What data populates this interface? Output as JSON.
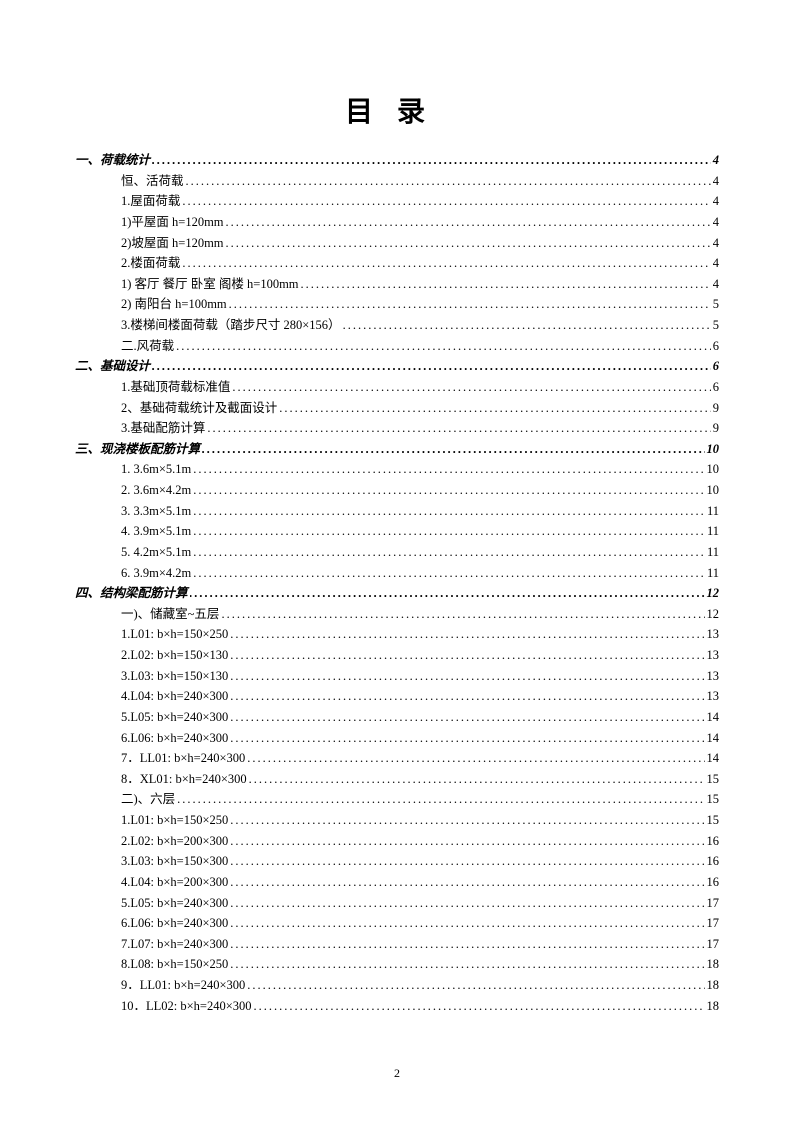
{
  "title": "目录",
  "pageNumber": "2",
  "toc": [
    {
      "level": 1,
      "label": "一、荷载统计",
      "page": "4"
    },
    {
      "level": 2,
      "label": "恒、活荷载",
      "page": "4"
    },
    {
      "level": 2,
      "label": "1.屋面荷载",
      "page": "4"
    },
    {
      "level": 2,
      "label": "1)平屋面  h=120mm",
      "page": "4"
    },
    {
      "level": 2,
      "label": "2)坡屋面  h=120mm",
      "page": "4"
    },
    {
      "level": 2,
      "label": "2.楼面荷载",
      "page": "4"
    },
    {
      "level": 2,
      "label": "1)    客厅  餐厅  卧室  阁楼 h=100mm",
      "page": "4"
    },
    {
      "level": 2,
      "label": "2)    南阳台 h=100mm",
      "page": "5"
    },
    {
      "level": 2,
      "label": "3.楼梯间楼面荷载（踏步尺寸 280×156）",
      "page": "5"
    },
    {
      "level": 2,
      "label": "二.风荷载",
      "page": "6"
    },
    {
      "level": 1,
      "label": "二、基础设计",
      "page": "6"
    },
    {
      "level": 2,
      "label": "1.基础顶荷载标准值",
      "page": "6"
    },
    {
      "level": 2,
      "label": "2、基础荷载统计及截面设计",
      "page": "9"
    },
    {
      "level": 2,
      "label": "3.基础配筋计算",
      "page": "9"
    },
    {
      "level": 1,
      "label": "三、现浇楼板配筋计算",
      "page": "10"
    },
    {
      "level": 2,
      "label": "1.     3.6m×5.1m",
      "page": "10"
    },
    {
      "level": 2,
      "label": "2.     3.6m×4.2m",
      "page": "10"
    },
    {
      "level": 2,
      "label": "3.     3.3m×5.1m",
      "page": "11"
    },
    {
      "level": 2,
      "label": "4.     3.9m×5.1m",
      "page": "11"
    },
    {
      "level": 2,
      "label": "5.     4.2m×5.1m",
      "page": "11"
    },
    {
      "level": 2,
      "label": "6.     3.9m×4.2m",
      "page": "11"
    },
    {
      "level": 1,
      "label": "四、结构梁配筋计算",
      "page": "12"
    },
    {
      "level": 2,
      "label": "一)、储藏室~五层",
      "page": "12"
    },
    {
      "level": 2,
      "label": "1.L01:    b×h=150×250",
      "page": "13"
    },
    {
      "level": 2,
      "label": "2.L02:    b×h=150×130",
      "page": "13"
    },
    {
      "level": 2,
      "label": "3.L03:    b×h=150×130",
      "page": "13"
    },
    {
      "level": 2,
      "label": "4.L04:    b×h=240×300",
      "page": "13"
    },
    {
      "level": 2,
      "label": "5.L05:    b×h=240×300",
      "page": "14"
    },
    {
      "level": 2,
      "label": "6.L06:    b×h=240×300",
      "page": "14"
    },
    {
      "level": 2,
      "label": "7．LL01:    b×h=240×300",
      "page": "14"
    },
    {
      "level": 2,
      "label": "8．XL01: b×h=240×300",
      "page": "15"
    },
    {
      "level": 2,
      "label": "二)、六层",
      "page": "15"
    },
    {
      "level": 2,
      "label": "1.L01: b×h=150×250",
      "page": "15"
    },
    {
      "level": 2,
      "label": "2.L02: b×h=200×300",
      "page": "16"
    },
    {
      "level": 2,
      "label": "3.L03: b×h=150×300",
      "page": "16"
    },
    {
      "level": 2,
      "label": "4.L04: b×h=200×300",
      "page": "16"
    },
    {
      "level": 2,
      "label": "5.L05:    b×h=240×300",
      "page": "17"
    },
    {
      "level": 2,
      "label": "6.L06:    b×h=240×300",
      "page": "17"
    },
    {
      "level": 2,
      "label": "7.L07:    b×h=240×300",
      "page": "17"
    },
    {
      "level": 2,
      "label": "8.L08:    b×h=150×250",
      "page": "18"
    },
    {
      "level": 2,
      "label": "9．LL01:    b×h=240×300",
      "page": "18"
    },
    {
      "level": 2,
      "label": "10．LL02:    b×h=240×300",
      "page": "18"
    }
  ]
}
